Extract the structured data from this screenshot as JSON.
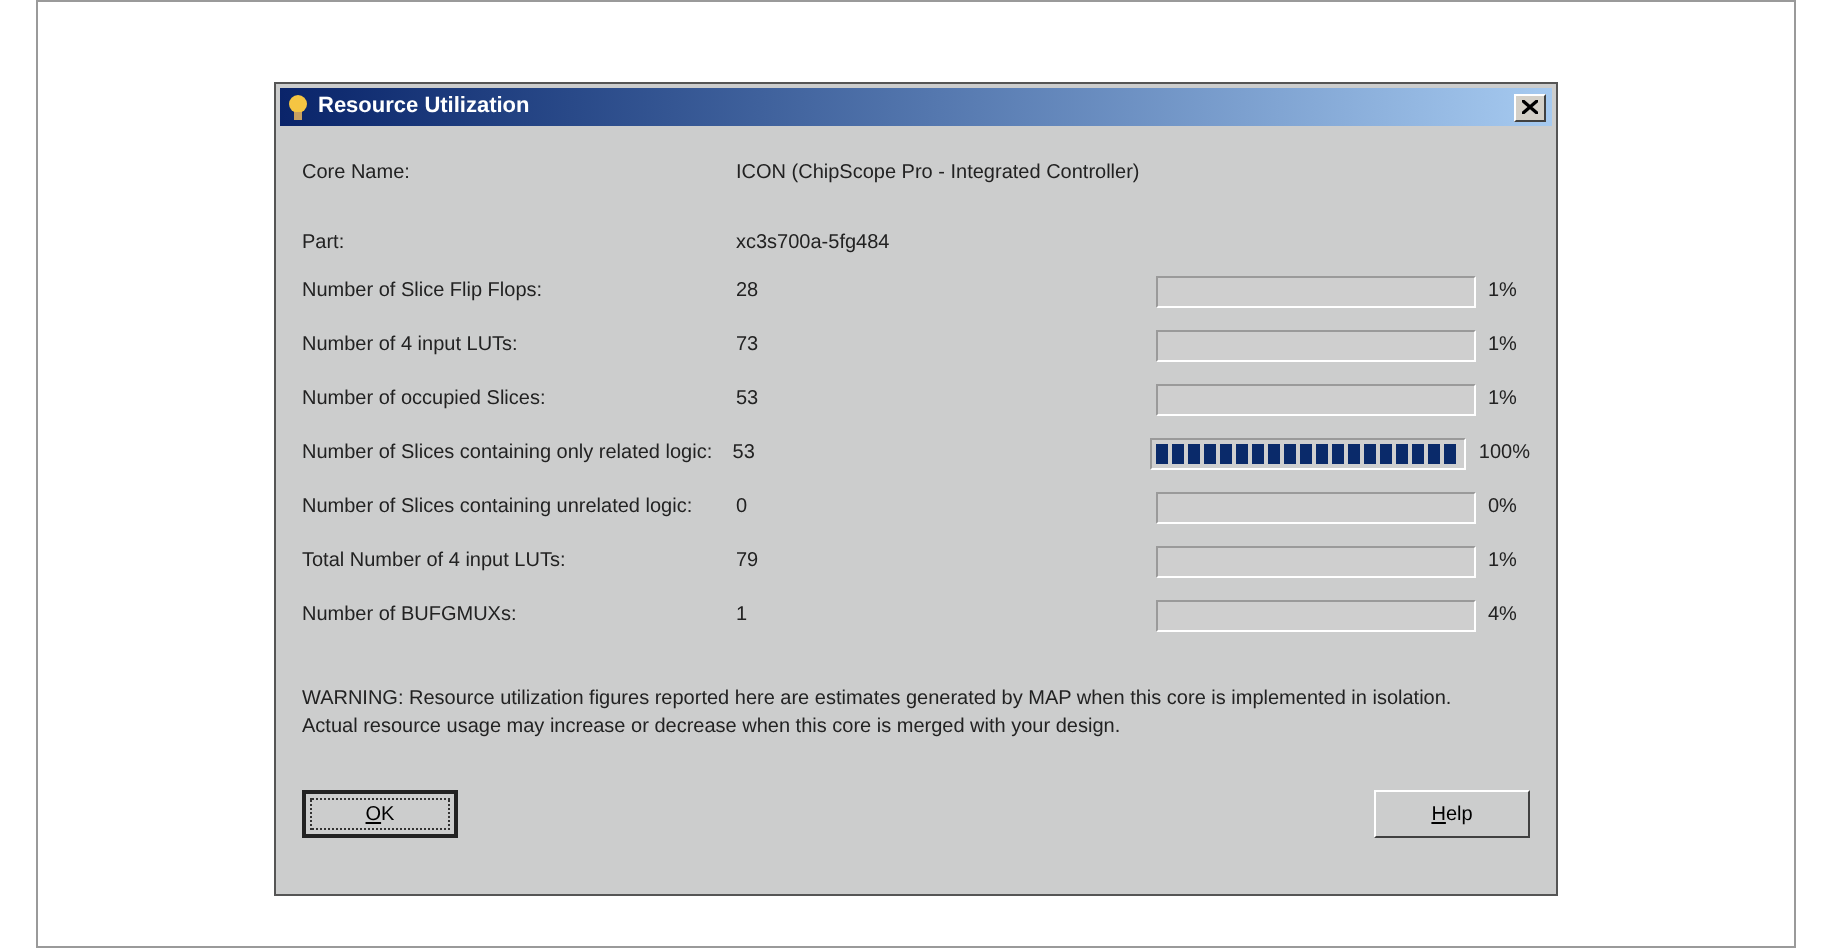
{
  "window": {
    "title": "Resource Utilization"
  },
  "core_name": {
    "label": "Core Name:",
    "value": "ICON (ChipScope Pro - Integrated Controller)"
  },
  "part": {
    "label": "Part:",
    "value": "xc3s700a-5fg484"
  },
  "rows": [
    {
      "label": "Number of Slice Flip Flops:",
      "value": "28",
      "reading": "1%"
    },
    {
      "label": "Number of 4 input LUTs:",
      "value": "73",
      "reading": "1%"
    },
    {
      "label": "Number of occupied Slices:",
      "value": "53",
      "reading": "1%"
    },
    {
      "label": "Number of Slices containing only related logic:",
      "value": "53",
      "level": 1,
      "reading": "100%"
    },
    {
      "label": "Number of Slices containing unrelated logic:",
      "value": "0",
      "reading": "0%"
    },
    {
      "label": "Total Number of 4 input LUTs:",
      "value": "79",
      "reading": "1%"
    },
    {
      "label": "Number of BUFGMUXs:",
      "value": "1",
      "reading": "4%"
    }
  ],
  "warning": [
    "WARNING: Resource utilization figures reported here are estimates generated by MAP when this core is implemented in isolation.",
    "Actual resource usage may increase or decrease when this core is merged with your design."
  ],
  "buttons": [
    {
      "label": "OK",
      "default": true
    },
    {
      "label": "Help",
      "default": false
    }
  ]
}
